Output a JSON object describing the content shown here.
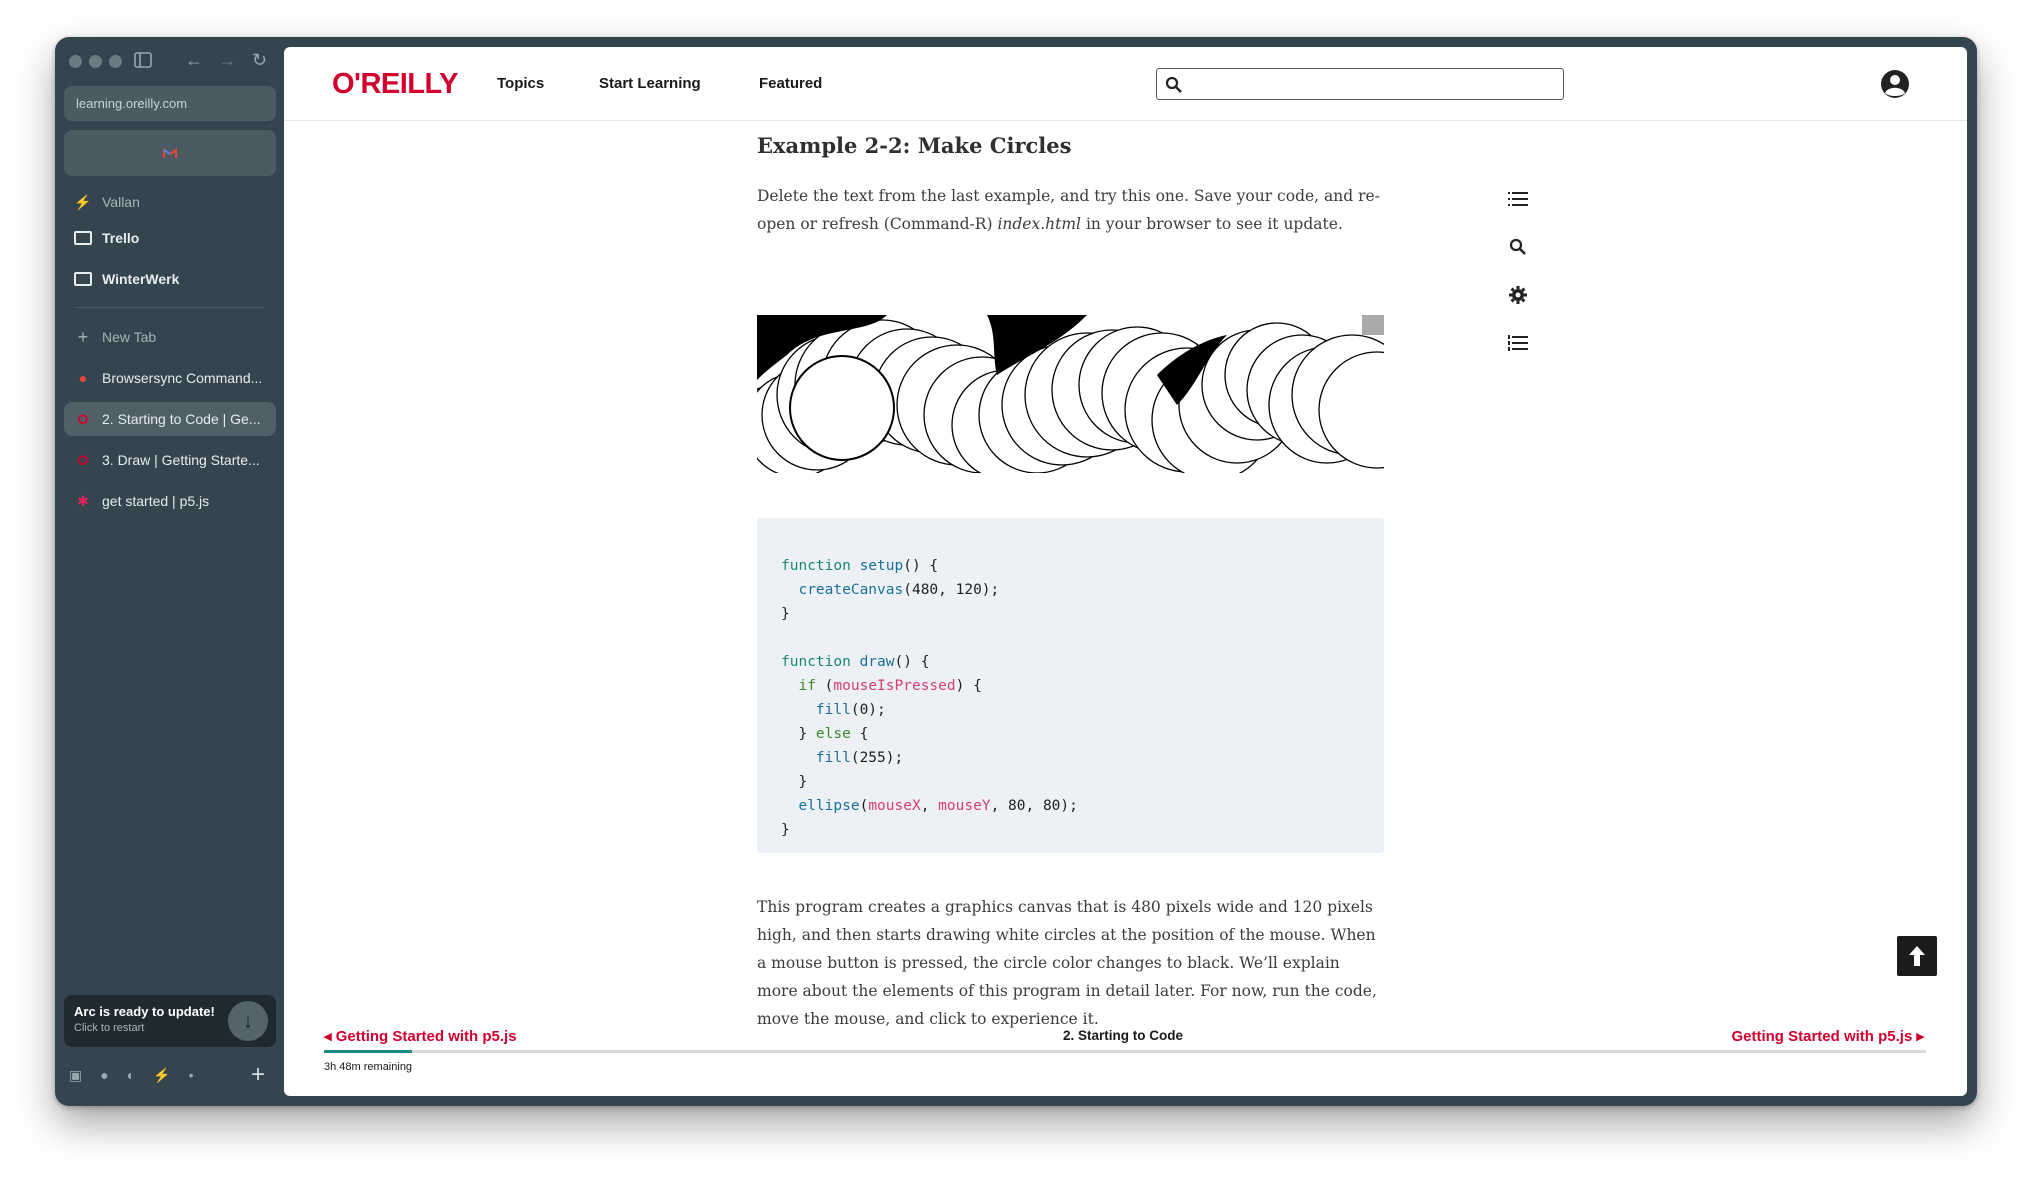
{
  "browser": {
    "url": "learning.oreilly.com",
    "space_label": "Vallan",
    "folders": [
      {
        "label": "Trello"
      },
      {
        "label": "WinterWerk"
      }
    ],
    "new_tab_label": "New Tab",
    "tabs": [
      {
        "label": "Browsersync Command...",
        "active": false
      },
      {
        "label": "2. Starting to Code | Ge...",
        "active": true
      },
      {
        "label": "3. Draw | Getting Starte...",
        "active": false
      },
      {
        "label": "get started | p5.js",
        "active": false
      }
    ],
    "update": {
      "title": "Arc is ready to update!",
      "subtitle": "Click to restart"
    }
  },
  "site": {
    "logo": "O'REILLY",
    "nav": [
      "Topics",
      "Start Learning",
      "Featured"
    ],
    "search_placeholder": ""
  },
  "article": {
    "heading": "Example 2-2: Make Circles",
    "intro_before": "Delete the text from the last example, and try this one. Save your code, and re-open or refresh (Command-R) ",
    "intro_italic": "index.html",
    "intro_after": " in your browser to see it update.",
    "code_lines": [
      "function setup() {",
      "  createCanvas(480, 120);",
      "}",
      "",
      "function draw() {",
      "  if (mouseIsPressed) {",
      "    fill(0);",
      "  } else {",
      "    fill(255);",
      "  }",
      "  ellipse(mouseX, mouseY, 80, 80);",
      "}"
    ],
    "body": "This program creates a graphics canvas that is 480 pixels wide and 120 pixels high, and then starts drawing white circles at the position of the mouse. When a mouse button is pressed, the circle color changes to black. We’ll explain more about the elements of this program in detail later. For now, run the code, move the mouse, and click to experience   it."
  },
  "footer": {
    "prev": "Getting Started with p5.js",
    "current": "2. Starting to Code",
    "next": "Getting Started with p5.js",
    "remaining": "3h 48m remaining",
    "progress": 0.055
  },
  "colors": {
    "brand": "#d3002d",
    "sidebar": "#34454f",
    "progress": "#1f8a80"
  }
}
